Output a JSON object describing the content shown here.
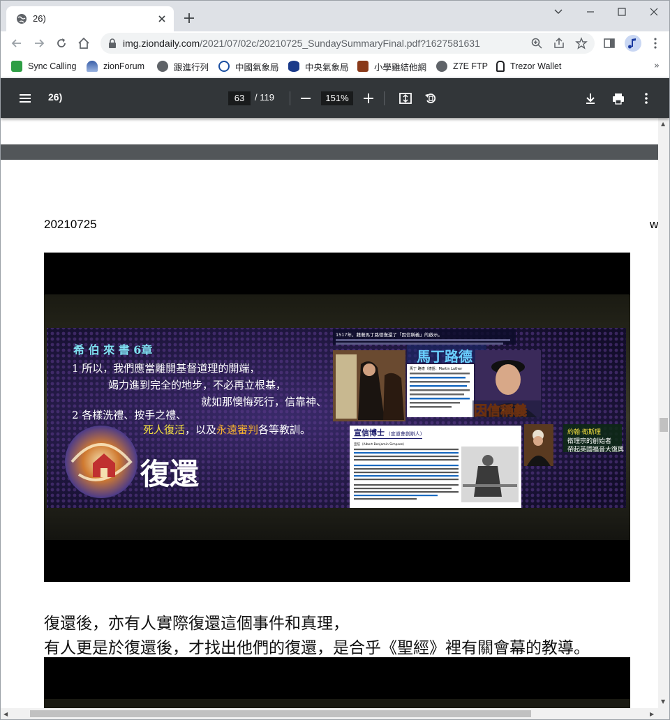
{
  "tab": {
    "title": "26)"
  },
  "toolbar": {
    "url_host": "img.ziondaily.com",
    "url_path": "/2021/07/02c/20210725_SundaySummaryFinal.pdf?1627581631"
  },
  "bookmarks": [
    {
      "label": "Sync Calling",
      "icon": "sync-calling-icon",
      "color": "#2e9e45"
    },
    {
      "label": "zionForum",
      "icon": "forum-icon",
      "color": "#3a5fa8"
    },
    {
      "label": "跟進行列",
      "icon": "globe-icon",
      "color": "#5f6368"
    },
    {
      "label": "中國氣象局",
      "icon": "cma-icon",
      "color": "#1a4ea0"
    },
    {
      "label": "中央氣象局",
      "icon": "cwb-icon",
      "color": "#1a3a8a"
    },
    {
      "label": "小學雞結他網",
      "icon": "guitar-icon",
      "color": "#8a3a1a"
    },
    {
      "label": "Z7E FTP",
      "icon": "globe-icon",
      "color": "#5f6368"
    },
    {
      "label": "Trezor Wallet",
      "icon": "lock-icon",
      "color": "#202124"
    }
  ],
  "pdf": {
    "title": "26)",
    "current_page": "63",
    "total_pages": "/ 119",
    "zoom": "151%"
  },
  "document": {
    "page_date": "20210725",
    "page_cut": "w",
    "slide": {
      "book_title": "希 伯 來 書 6章",
      "verse_line1": "1 所以，我們應當離開基督道理的開端，",
      "verse_line2": "竭力進到完全的地步，不必再立根基，",
      "verse_line3": "就如那懊悔死行，信靠神、",
      "verse_line4": "2 各樣洗禮、按手之禮、",
      "verse_hl1": "死人復活",
      "verse_mid": "，以及",
      "verse_hl2": "永遠審判",
      "verse_end": "各等教訓。",
      "big_title": "復還",
      "luther_banner": "馬丁路德",
      "luther_name": "馬丁‧路德（德語：Martin Luther",
      "luther_tag": "因信稱義",
      "simpson_banner": "宣信博士",
      "simpson_sub": "(宣道會創辦人)",
      "simpson_name": "宣信（Albert Benjamin Simpson）",
      "wesley_name": "約翰‧衛斯理",
      "wesley_line1": "衛理宗的創始者",
      "wesley_line2": "帶起英國福音大復興",
      "top_strip": "1517年，藉著馬丁路德復還了「因信稱義」的啟示。"
    },
    "caption_line1": "復還後，亦有人實際復還這個事件和真理，",
    "caption_line2": "有人更是於復還後，才找出他們的復還，是合乎《聖經》裡有關會幕的教導。"
  }
}
